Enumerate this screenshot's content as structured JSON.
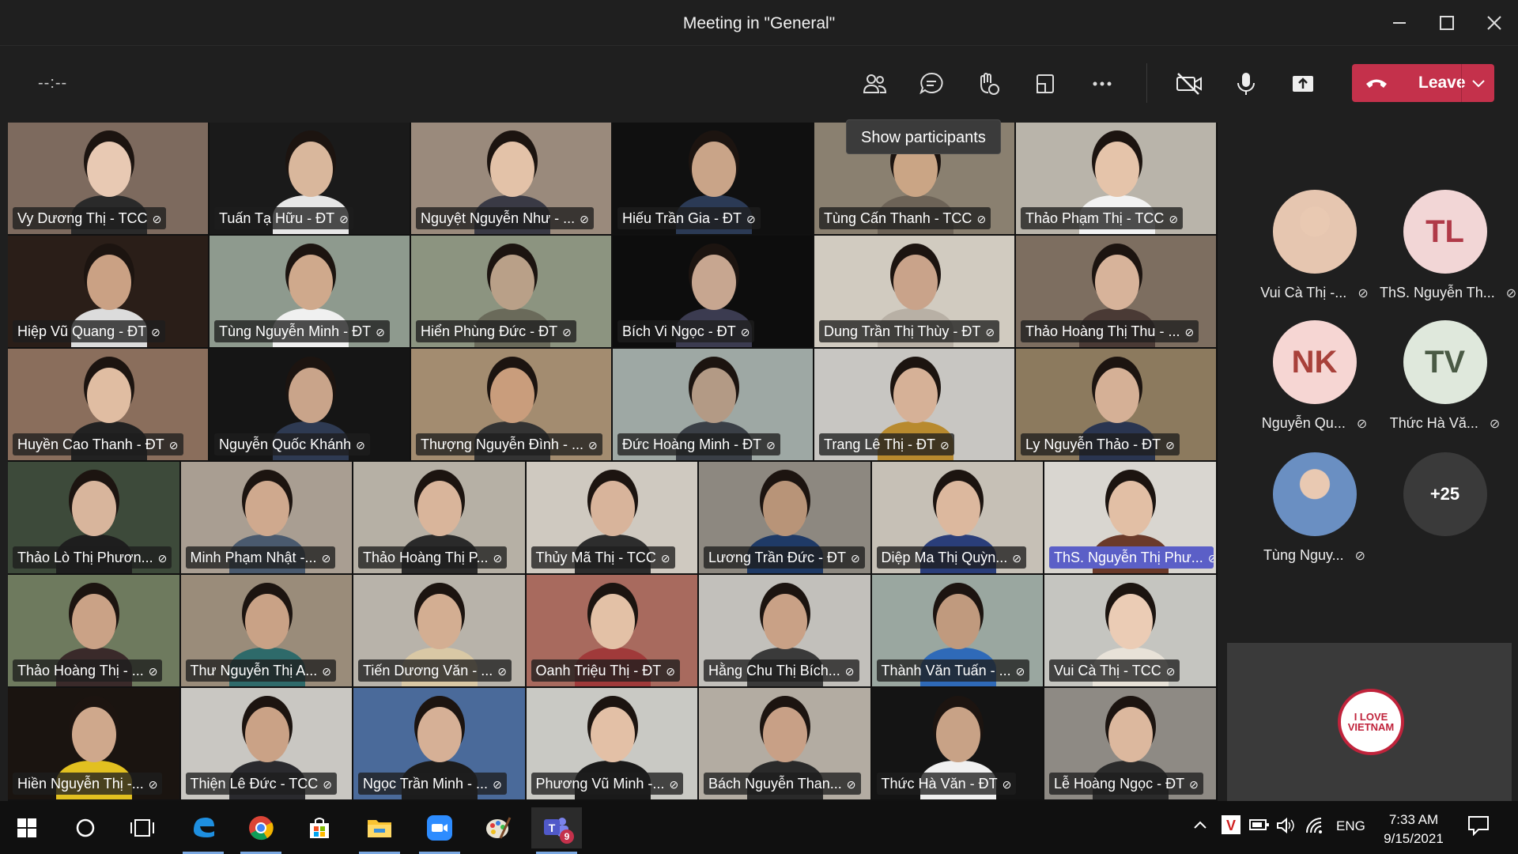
{
  "window": {
    "title": "Meeting in \"General\""
  },
  "toolbar": {
    "timer": "--:--",
    "leave_label": "Leave",
    "tooltip": "Show participants"
  },
  "tiles": [
    {
      "name": "Vy Dương Thị - TCC",
      "bg": "#7d6a5e",
      "skin": "#e8c9b3",
      "shirt": "#2a2a2a"
    },
    {
      "name": "Tuấn Tạ Hữu - ĐT",
      "bg": "#1a1a1a",
      "skin": "#d9b79c",
      "shirt": "#e6e6e6"
    },
    {
      "name": "Nguyệt Nguyễn Như - ...",
      "bg": "#9a8a7c",
      "skin": "#e3c2a8",
      "shirt": "#3a3a45"
    },
    {
      "name": "Hiếu Trần Gia - ĐT",
      "bg": "#101010",
      "skin": "#c9a488",
      "shirt": "#2b3a55"
    },
    {
      "name": "Tùng Cấn Thanh - TCC",
      "bg": "#8a8070",
      "skin": "#caa585",
      "shirt": "#6d6357"
    },
    {
      "name": "Thảo Phạm Thị - TCC",
      "bg": "#b9b4aa",
      "skin": "#e5c4aa",
      "shirt": "#f2f2f2"
    },
    {
      "name": "Hiệp Vũ Quang - ĐT",
      "bg": "#2a1e18",
      "skin": "#caa184",
      "shirt": "#dcdcdc"
    },
    {
      "name": "Tùng Nguyễn Minh - ĐT",
      "bg": "#8e9a8e",
      "skin": "#cfa98c",
      "shirt": "#f0f0f0"
    },
    {
      "name": "Hiển Phùng Đức - ĐT",
      "bg": "#8c9480",
      "skin": "#b9a088",
      "shirt": "#6a6a5a"
    },
    {
      "name": "Bích Vi Ngọc - ĐT",
      "bg": "#0d0d0d",
      "skin": "#c7a690",
      "shirt": "#3b3b50"
    },
    {
      "name": "Dung Trần Thị Thùy - ĐT",
      "bg": "#d1cbc0",
      "skin": "#c9a38a",
      "shirt": "#b8b0a5"
    },
    {
      "name": "Thảo Hoàng Thị Thu - ...",
      "bg": "#7d6e60",
      "skin": "#d7b39a",
      "shirt": "#4a3a35"
    },
    {
      "name": "Huyền Cao Thanh - ĐT",
      "bg": "#8a6e5c",
      "skin": "#e0bda2",
      "shirt": "#222"
    },
    {
      "name": "Nguyễn Quốc Khánh",
      "bg": "#151515",
      "skin": "#c9a48a",
      "shirt": "#2e3a52"
    },
    {
      "name": "Thượng Nguyễn Đình - ...",
      "bg": "#a38c70",
      "skin": "#c99d7c",
      "shirt": "#333"
    },
    {
      "name": "Đức Hoàng Minh - ĐT",
      "bg": "#9ea8a4",
      "skin": "#b39a85",
      "shirt": "#3a3f46"
    },
    {
      "name": "Trang Lê Thị - ĐT",
      "bg": "#c8c6c2",
      "skin": "#d6b197",
      "shirt": "#b88a2e"
    },
    {
      "name": "Ly Nguyễn Thảo - ĐT",
      "bg": "#8c7a5e",
      "skin": "#d5b096",
      "shirt": "#2a3550"
    },
    {
      "name": "Thảo Lò Thị Phươn...",
      "bg": "#3d4a3a",
      "skin": "#d8b59c",
      "shirt": "#1e1e1e"
    },
    {
      "name": "Minh Phạm Nhật -...",
      "bg": "#a99e92",
      "skin": "#cfa98e",
      "shirt": "#4a5a6e"
    },
    {
      "name": "Thảo Hoàng Thị P...",
      "bg": "#b6b0a5",
      "skin": "#d9b59b",
      "shirt": "#2a2a2a"
    },
    {
      "name": "Thủy Mã Thị - TCC",
      "bg": "#cfc9c0",
      "skin": "#d8b49b",
      "shirt": "#2d2d2d"
    },
    {
      "name": "Lương Trần Đức - ĐT",
      "bg": "#8d8880",
      "skin": "#b89478",
      "shirt": "#1f3a66"
    },
    {
      "name": "Diệp Ma Thị Quỳn...",
      "bg": "#c6c0b6",
      "skin": "#dcb89e",
      "shirt": "#2a3e7a"
    },
    {
      "name": "ThS. Nguyễn Thị Phư...",
      "bg": "#d9d6d0",
      "skin": "#e2bfa5",
      "shirt": "#6a3a2a",
      "highlight": true
    },
    {
      "name": "Thảo Hoàng Thị - ...",
      "bg": "#6e7a5e",
      "skin": "#caa286",
      "shirt": "#3a2a2a"
    },
    {
      "name": "Thư Nguyễn Thị A...",
      "bg": "#9a8c7a",
      "skin": "#c9a286",
      "shirt": "#2e6a6a"
    },
    {
      "name": "Tiến Dương Văn - ...",
      "bg": "#b8b3aa",
      "skin": "#d3ae92",
      "shirt": "#d9c8a5"
    },
    {
      "name": "Oanh Triệu Thị - ĐT",
      "bg": "#a86a5e",
      "skin": "#e3c1a6",
      "shirt": "#a03a3a"
    },
    {
      "name": "Hằng Chu Thị Bích...",
      "bg": "#c2c0bb",
      "skin": "#c9a186",
      "shirt": "#3a3a3a"
    },
    {
      "name": "Thành Văn Tuấn - ...",
      "bg": "#9aa7a0",
      "skin": "#c09a7e",
      "shirt": "#2f6ab8"
    },
    {
      "name": "Vui Cà Thị - TCC",
      "bg": "#c5c5c0",
      "skin": "#ebccb5",
      "shirt": "#e8e2d8"
    },
    {
      "name": "Hiền Nguyễn Thị -...",
      "bg": "#1a1410",
      "skin": "#cfa88c",
      "shirt": "#e2c020"
    },
    {
      "name": "Thiện Lê Đức - TCC",
      "bg": "#c9c7c2",
      "skin": "#caa286",
      "shirt": "#2a2a2e"
    },
    {
      "name": "Ngọc Trần Minh - ...",
      "bg": "#4a6a9a",
      "skin": "#d6b096",
      "shirt": "#1c1c1c"
    },
    {
      "name": "Phương Vũ Minh -...",
      "bg": "#c9c9c4",
      "skin": "#e3c0a6",
      "shirt": "#1a1a1a"
    },
    {
      "name": "Bách Nguyễn Than...",
      "bg": "#b3aca2",
      "skin": "#c8a086",
      "shirt": "#2a2a2a"
    },
    {
      "name": "Thức Hà Văn - ĐT",
      "bg": "#141414",
      "skin": "#c8a286",
      "shirt": "#f0f0f0"
    },
    {
      "name": "Lễ Hoàng Ngọc - ĐT",
      "bg": "#8e8a84",
      "skin": "#dcb89e",
      "shirt": "#2b2b2b"
    }
  ],
  "participants": [
    {
      "name": "Vui Cà Thị -...",
      "initials": "",
      "type": "photo",
      "color": "#e6c6b0"
    },
    {
      "name": "ThS. Nguyễn Th...",
      "initials": "TL",
      "type": "initials",
      "color": "#f2d6d6",
      "fg": "#b03a48"
    },
    {
      "name": "Nguyễn Qu...",
      "initials": "NK",
      "type": "initials",
      "color": "#f6d6d3",
      "fg": "#a8413a"
    },
    {
      "name": "Thức Hà Vă...",
      "initials": "TV",
      "type": "initials",
      "color": "#dfe8dc",
      "fg": "#4a5a45"
    },
    {
      "name": "Tùng Nguy...",
      "initials": "",
      "type": "photo",
      "color": "#6a8fc2"
    },
    {
      "name": "",
      "initials": "+25",
      "type": "more",
      "color": "#3a3a3a",
      "fg": "#ffffff"
    }
  ],
  "own_video": {
    "logo_text": "I LOVE VIETNAM"
  },
  "taskbar": {
    "lang": "ENG",
    "time": "7:33 AM",
    "date": "9/15/2021",
    "teams_badge": "9"
  },
  "icons": [
    "windows-start-icon",
    "search-circle-icon",
    "task-view-icon",
    "edge-icon",
    "chrome-icon",
    "store-icon",
    "file-explorer-icon",
    "zoom-icon",
    "paint-icon",
    "teams-icon"
  ]
}
